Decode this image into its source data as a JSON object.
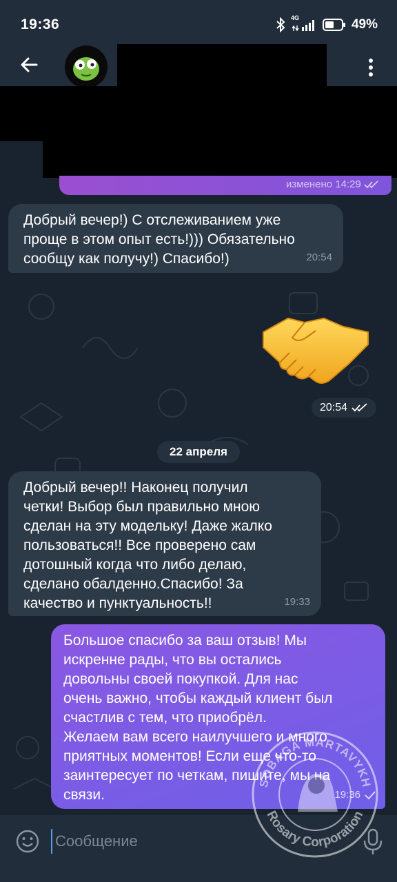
{
  "status_bar": {
    "time": "19:36",
    "network": "4G",
    "battery": "49%",
    "icons": [
      "bluetooth-icon",
      "signal-icon",
      "battery-icon"
    ]
  },
  "header": {
    "back_icon": "arrow-left-icon",
    "menu_icon": "more-vertical-icon"
  },
  "messages": {
    "edited_label": "изменено 14:29",
    "msg1": {
      "lines": [
        "Добрый вечер!) С отслеживанием уже",
        "проще в этом опыт есть!))) Обязательно",
        "сообщу как получу!) Спасибо!)"
      ],
      "time": "20:54"
    },
    "sticker": {
      "emoji": "handshake",
      "time": "20:54"
    },
    "date_separator": "22 апреля",
    "msg2": {
      "lines": [
        "Добрый вечер!! Наконец получил",
        "четки! Выбор был правильно мною",
        "сделан на эту модельку! Даже жалко",
        "пользоваться!! Все проверено сам",
        "дотошный когда что либо делаю,",
        "сделано обалденно.Спасибо! За",
        "качество и пунктуальность!!"
      ],
      "time": "19:33"
    },
    "msg3": {
      "lines": [
        "Большое спасибо за ваш отзыв! Мы",
        "искренне рады, что вы остались",
        "довольны своей покупкой. Для нас",
        "очень важно, чтобы каждый клиент был",
        "счастлив с тем, что приобрёл.",
        "Желаем вам всего наилучшего и много",
        "приятных моментов! Если еще что-то",
        "заинтересует по четкам, пишите, мы на",
        "связи."
      ],
      "time": "19:36"
    }
  },
  "input": {
    "placeholder": "Сообщение",
    "emoji_icon": "emoji-icon",
    "mic_icon": "microphone-icon"
  },
  "watermark": {
    "top": "SOBAGA MARTAVYKH",
    "bottom": "Rosary Corporation"
  },
  "colors": {
    "background": "#18232f",
    "header": "#212d3b",
    "incoming": "#2d3a48",
    "outgoing_start": "#8a58e2",
    "outgoing_end": "#6f5fe8"
  }
}
